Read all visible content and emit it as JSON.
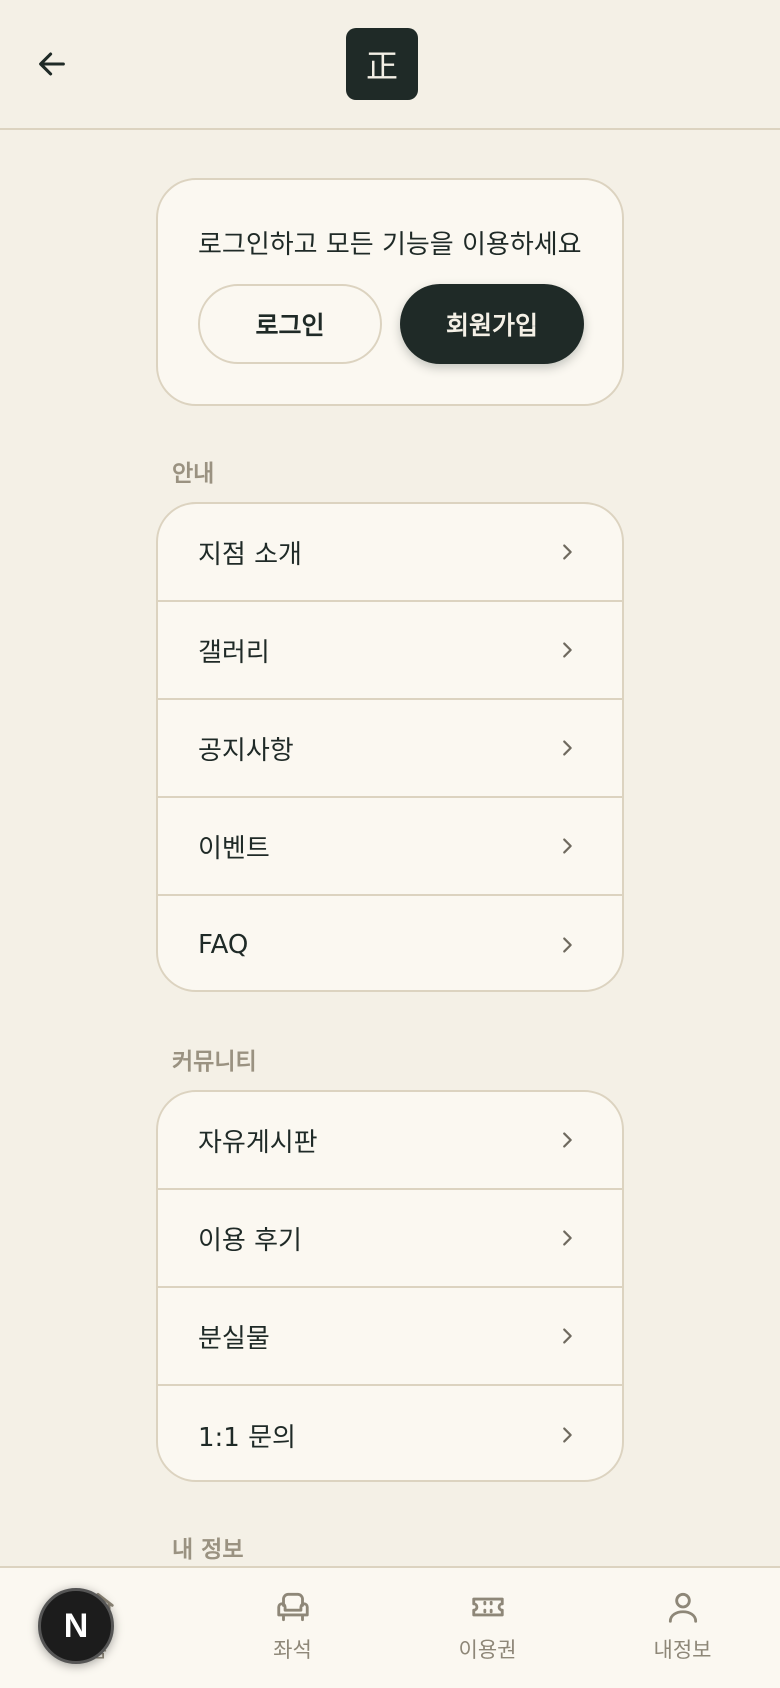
{
  "header": {
    "logo_text": "正",
    "back_icon": "arrow-left-icon"
  },
  "login_card": {
    "prompt": "로그인하고 모든 기능을 이용하세요",
    "login_label": "로그인",
    "signup_label": "회원가입"
  },
  "sections": [
    {
      "label": "안내",
      "items": [
        "지점 소개",
        "갤러리",
        "공지사항",
        "이벤트",
        "FAQ"
      ]
    },
    {
      "label": "커뮤니티",
      "items": [
        "자유게시판",
        "이용 후기",
        "분실물",
        "1:1 문의"
      ]
    },
    {
      "label": "내 정보",
      "items": []
    }
  ],
  "tabbar": {
    "tabs": [
      {
        "label": "홈",
        "icon": "home-icon"
      },
      {
        "label": "좌석",
        "icon": "seat-icon"
      },
      {
        "label": "이용권",
        "icon": "ticket-icon"
      },
      {
        "label": "내정보",
        "icon": "user-icon"
      }
    ]
  },
  "n_badge": "N",
  "colors": {
    "background": "#f4f0e6",
    "card": "#fbf8f1",
    "primary": "#1f2a27",
    "border": "#dcd3c0",
    "muted": "#9a9281"
  }
}
